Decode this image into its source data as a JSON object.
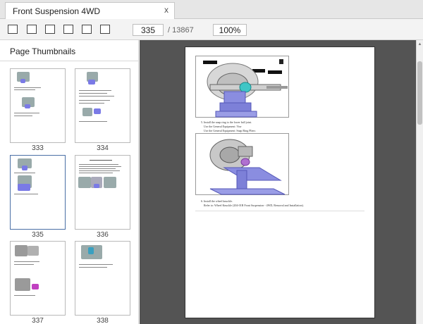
{
  "tab": {
    "title": "Front Suspension 4WD",
    "close": "x"
  },
  "toolbar": {
    "buttons": [
      "sidebar-toggle",
      "first-page",
      "previous-page",
      "next-page",
      "last-page",
      "fullscreen"
    ],
    "page_value": "335",
    "page_total": "/ 13867",
    "zoom_value": "100%"
  },
  "sidebar": {
    "title": "Page Thumbnails",
    "selected_page": "335",
    "thumbnails": [
      {
        "page": "333"
      },
      {
        "page": "334"
      },
      {
        "page": "335"
      },
      {
        "page": "336"
      },
      {
        "page": "337"
      },
      {
        "page": "338"
      }
    ]
  },
  "document": {
    "step5_title": "5.  Install the snap ring to the lower ball joint.",
    "step5_line1": "Use the General Equipment: Vise",
    "step5_line2": "Use the General Equipment: Snap Ring Pliers",
    "step6_title": "6.  Install the wheel knuckle.",
    "step6_line1": "Refer to: Wheel Knuckle (204-01B Front Suspension - 4WD, Removal and Installation)."
  },
  "colors": {
    "accent": "#4a6fa5",
    "viewer_bg": "#545454",
    "illustration_blue": "#8a8de0"
  }
}
